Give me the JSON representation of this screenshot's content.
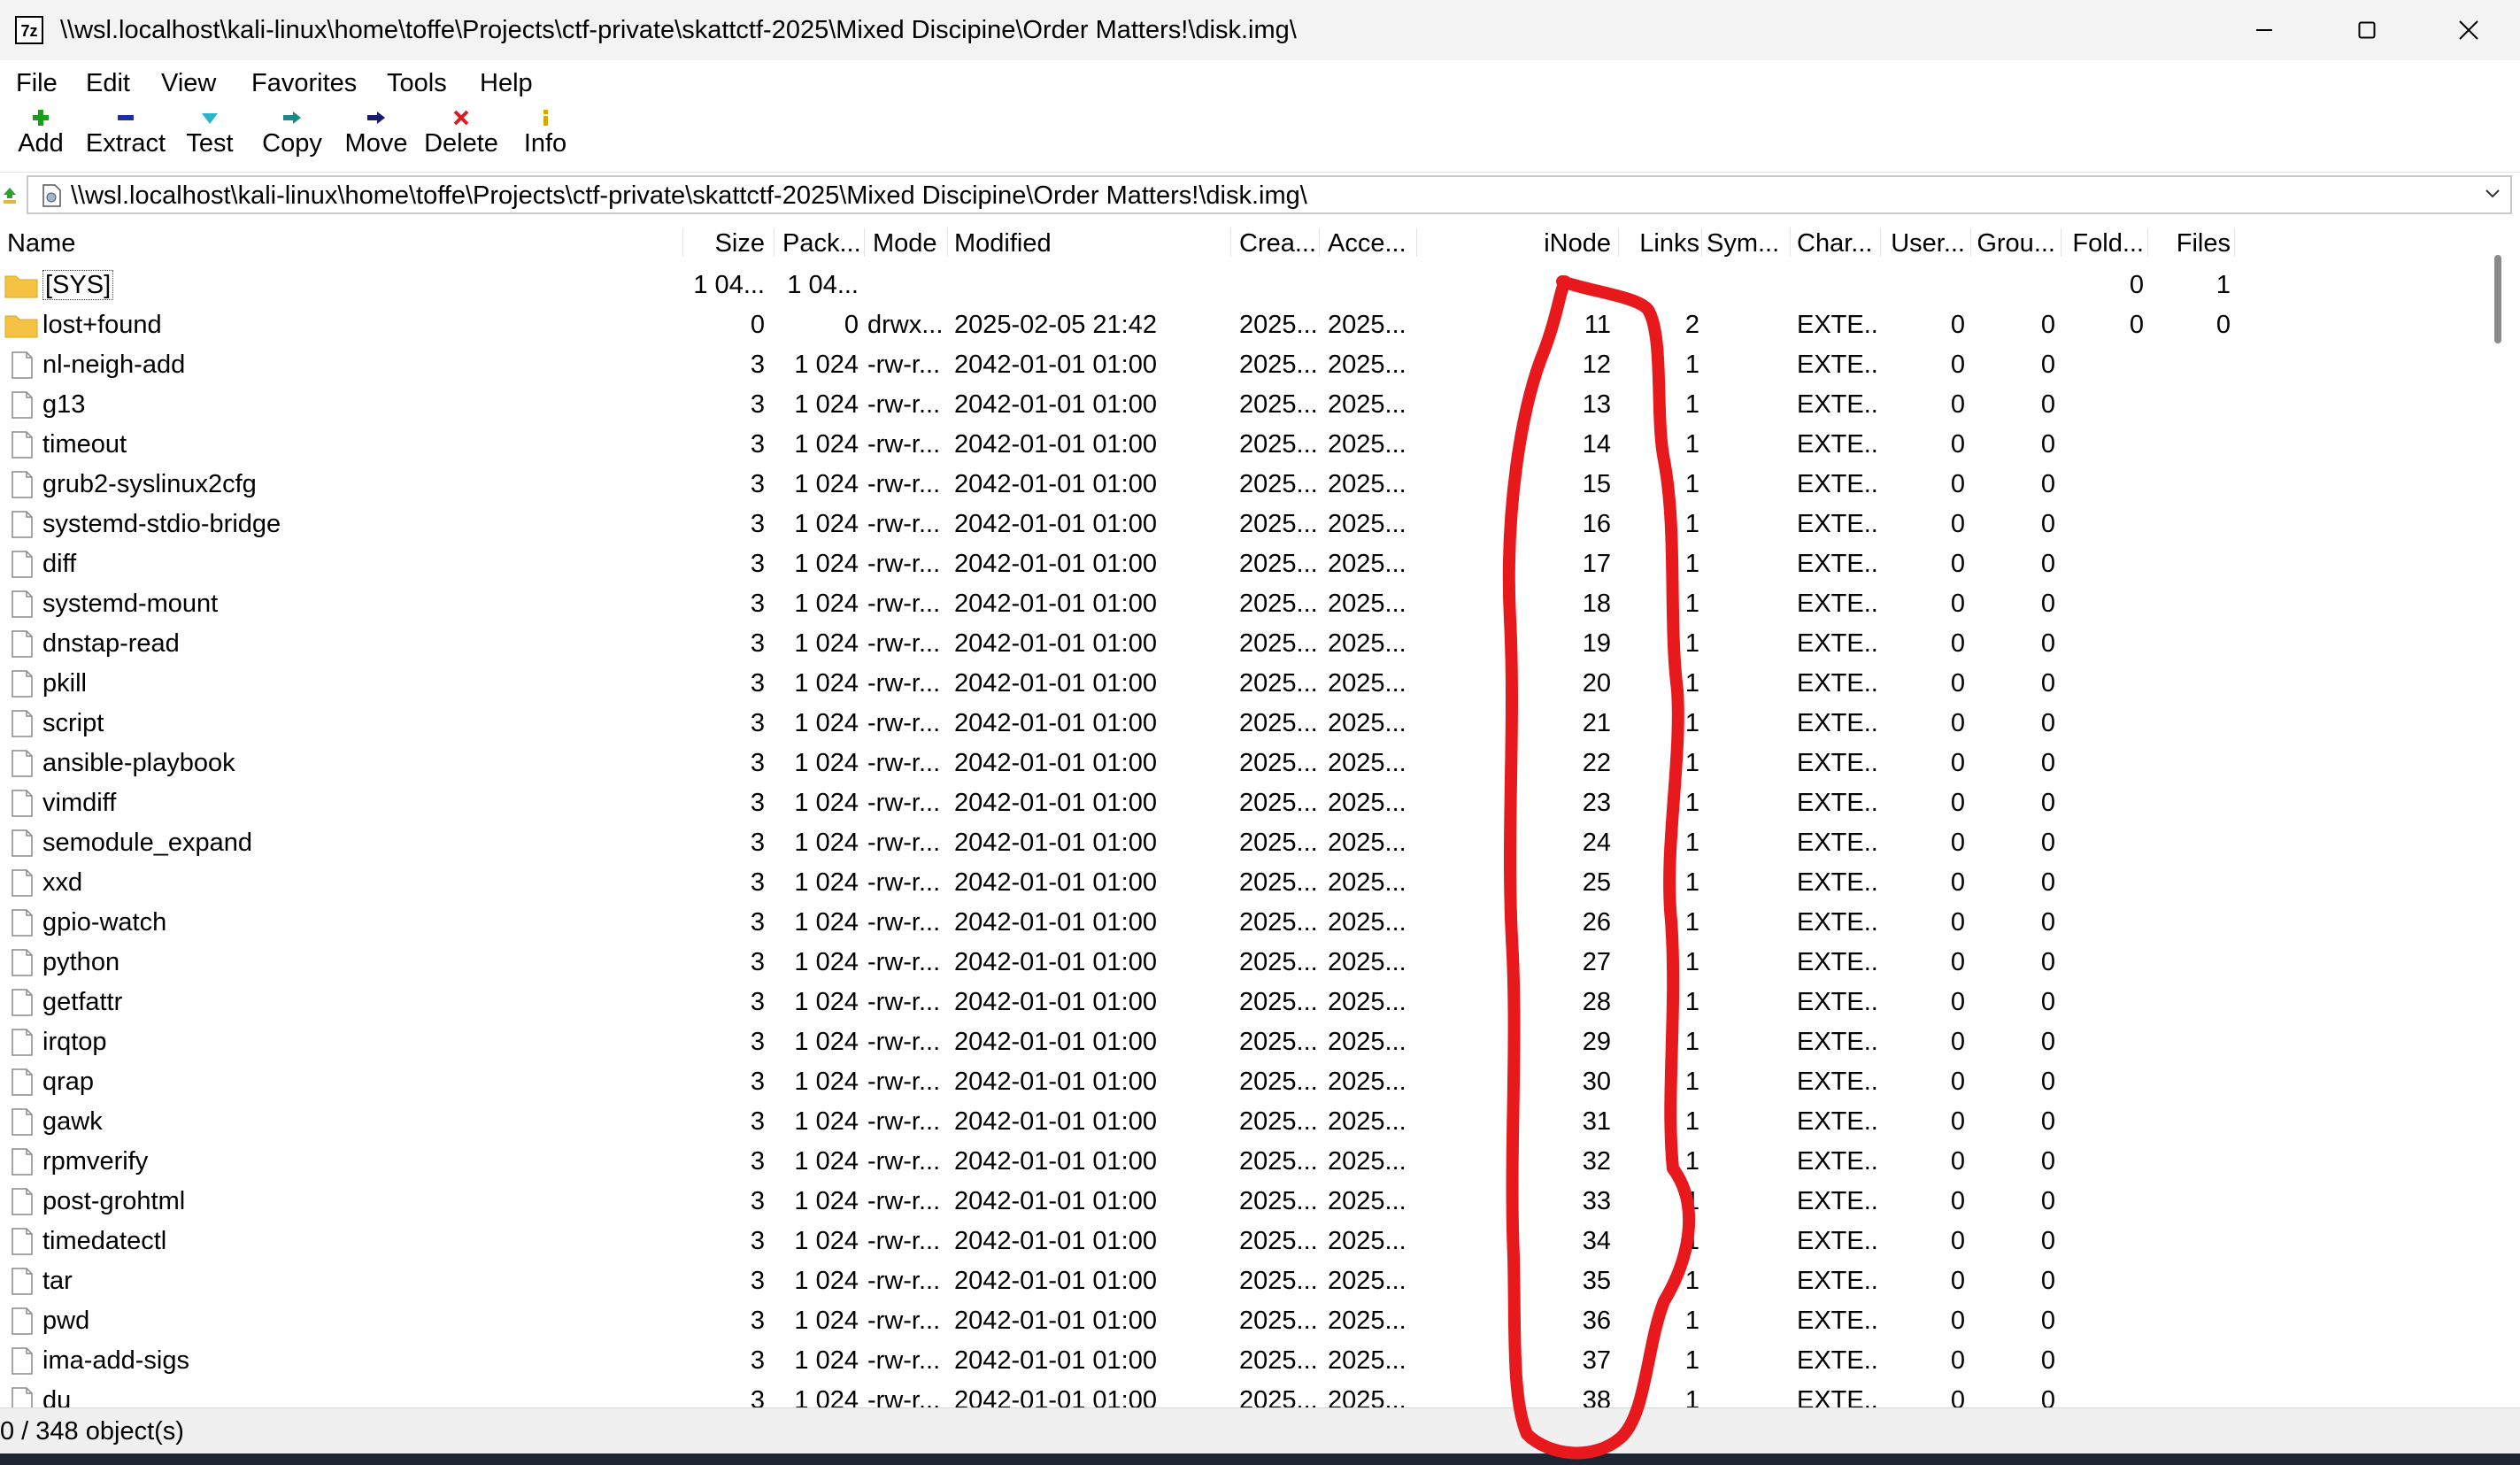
{
  "window": {
    "title": "\\\\wsl.localhost\\kali-linux\\home\\toffe\\Projects\\ctf-private\\skattctf-2025\\Mixed Discipine\\Order Matters!\\disk.img\\",
    "app_icon_text": "7z"
  },
  "menu": [
    "File",
    "Edit",
    "View",
    "Favorites",
    "Tools",
    "Help"
  ],
  "toolbar": {
    "add": "Add",
    "extract": "Extract",
    "test": "Test",
    "copy": "Copy",
    "move": "Move",
    "delete": "Delete",
    "info": "Info"
  },
  "address": {
    "path": "\\\\wsl.localhost\\kali-linux\\home\\toffe\\Projects\\ctf-private\\skattctf-2025\\Mixed Discipine\\Order Matters!\\disk.img\\"
  },
  "columns": {
    "name": "Name",
    "size": "Size",
    "packed": "Pack...",
    "mode": "Mode",
    "modified": "Modified",
    "created": "Crea...",
    "accessed": "Acce...",
    "inode": "iNode",
    "links": "Links",
    "symlink": "Sym...",
    "characteristics": "Char...",
    "user": "User...",
    "group": "Grou...",
    "folders": "Fold...",
    "files": "Files"
  },
  "rows": [
    {
      "name": "[SYS]",
      "type": "folder",
      "size": "1 04...",
      "packed": "1 04...",
      "mode": "",
      "modified": "",
      "created": "",
      "accessed": "",
      "inode": "",
      "links": "",
      "char": "",
      "user": "",
      "group": "",
      "folders": "0",
      "files": "1"
    },
    {
      "name": "lost+found",
      "type": "folder",
      "size": "0",
      "packed": "0",
      "mode": "drwx...",
      "modified": "2025-02-05 21:42",
      "created": "2025...",
      "accessed": "2025...",
      "inode": "11",
      "links": "2",
      "char": "EXTE...",
      "user": "0",
      "group": "0",
      "folders": "0",
      "files": "0"
    },
    {
      "name": "nl-neigh-add",
      "type": "file",
      "size": "3",
      "packed": "1 024",
      "mode": "-rw-r...",
      "modified": "2042-01-01 01:00",
      "created": "2025...",
      "accessed": "2025...",
      "inode": "12",
      "links": "1",
      "char": "EXTE...",
      "user": "0",
      "group": "0",
      "folders": "",
      "files": ""
    },
    {
      "name": "g13",
      "type": "file",
      "size": "3",
      "packed": "1 024",
      "mode": "-rw-r...",
      "modified": "2042-01-01 01:00",
      "created": "2025...",
      "accessed": "2025...",
      "inode": "13",
      "links": "1",
      "char": "EXTE...",
      "user": "0",
      "group": "0",
      "folders": "",
      "files": ""
    },
    {
      "name": "timeout",
      "type": "file",
      "size": "3",
      "packed": "1 024",
      "mode": "-rw-r...",
      "modified": "2042-01-01 01:00",
      "created": "2025...",
      "accessed": "2025...",
      "inode": "14",
      "links": "1",
      "char": "EXTE...",
      "user": "0",
      "group": "0",
      "folders": "",
      "files": ""
    },
    {
      "name": "grub2-syslinux2cfg",
      "type": "file",
      "size": "3",
      "packed": "1 024",
      "mode": "-rw-r...",
      "modified": "2042-01-01 01:00",
      "created": "2025...",
      "accessed": "2025...",
      "inode": "15",
      "links": "1",
      "char": "EXTE...",
      "user": "0",
      "group": "0",
      "folders": "",
      "files": ""
    },
    {
      "name": "systemd-stdio-bridge",
      "type": "file",
      "size": "3",
      "packed": "1 024",
      "mode": "-rw-r...",
      "modified": "2042-01-01 01:00",
      "created": "2025...",
      "accessed": "2025...",
      "inode": "16",
      "links": "1",
      "char": "EXTE...",
      "user": "0",
      "group": "0",
      "folders": "",
      "files": ""
    },
    {
      "name": "diff",
      "type": "file",
      "size": "3",
      "packed": "1 024",
      "mode": "-rw-r...",
      "modified": "2042-01-01 01:00",
      "created": "2025...",
      "accessed": "2025...",
      "inode": "17",
      "links": "1",
      "char": "EXTE...",
      "user": "0",
      "group": "0",
      "folders": "",
      "files": ""
    },
    {
      "name": "systemd-mount",
      "type": "file",
      "size": "3",
      "packed": "1 024",
      "mode": "-rw-r...",
      "modified": "2042-01-01 01:00",
      "created": "2025...",
      "accessed": "2025...",
      "inode": "18",
      "links": "1",
      "char": "EXTE...",
      "user": "0",
      "group": "0",
      "folders": "",
      "files": ""
    },
    {
      "name": "dnstap-read",
      "type": "file",
      "size": "3",
      "packed": "1 024",
      "mode": "-rw-r...",
      "modified": "2042-01-01 01:00",
      "created": "2025...",
      "accessed": "2025...",
      "inode": "19",
      "links": "1",
      "char": "EXTE...",
      "user": "0",
      "group": "0",
      "folders": "",
      "files": ""
    },
    {
      "name": "pkill",
      "type": "file",
      "size": "3",
      "packed": "1 024",
      "mode": "-rw-r...",
      "modified": "2042-01-01 01:00",
      "created": "2025...",
      "accessed": "2025...",
      "inode": "20",
      "links": "1",
      "char": "EXTE...",
      "user": "0",
      "group": "0",
      "folders": "",
      "files": ""
    },
    {
      "name": "script",
      "type": "file",
      "size": "3",
      "packed": "1 024",
      "mode": "-rw-r...",
      "modified": "2042-01-01 01:00",
      "created": "2025...",
      "accessed": "2025...",
      "inode": "21",
      "links": "1",
      "char": "EXTE...",
      "user": "0",
      "group": "0",
      "folders": "",
      "files": ""
    },
    {
      "name": "ansible-playbook",
      "type": "file",
      "size": "3",
      "packed": "1 024",
      "mode": "-rw-r...",
      "modified": "2042-01-01 01:00",
      "created": "2025...",
      "accessed": "2025...",
      "inode": "22",
      "links": "1",
      "char": "EXTE...",
      "user": "0",
      "group": "0",
      "folders": "",
      "files": ""
    },
    {
      "name": "vimdiff",
      "type": "file",
      "size": "3",
      "packed": "1 024",
      "mode": "-rw-r...",
      "modified": "2042-01-01 01:00",
      "created": "2025...",
      "accessed": "2025...",
      "inode": "23",
      "links": "1",
      "char": "EXTE...",
      "user": "0",
      "group": "0",
      "folders": "",
      "files": ""
    },
    {
      "name": "semodule_expand",
      "type": "file",
      "size": "3",
      "packed": "1 024",
      "mode": "-rw-r...",
      "modified": "2042-01-01 01:00",
      "created": "2025...",
      "accessed": "2025...",
      "inode": "24",
      "links": "1",
      "char": "EXTE...",
      "user": "0",
      "group": "0",
      "folders": "",
      "files": ""
    },
    {
      "name": "xxd",
      "type": "file",
      "size": "3",
      "packed": "1 024",
      "mode": "-rw-r...",
      "modified": "2042-01-01 01:00",
      "created": "2025...",
      "accessed": "2025...",
      "inode": "25",
      "links": "1",
      "char": "EXTE...",
      "user": "0",
      "group": "0",
      "folders": "",
      "files": ""
    },
    {
      "name": "gpio-watch",
      "type": "file",
      "size": "3",
      "packed": "1 024",
      "mode": "-rw-r...",
      "modified": "2042-01-01 01:00",
      "created": "2025...",
      "accessed": "2025...",
      "inode": "26",
      "links": "1",
      "char": "EXTE...",
      "user": "0",
      "group": "0",
      "folders": "",
      "files": ""
    },
    {
      "name": "python",
      "type": "file",
      "size": "3",
      "packed": "1 024",
      "mode": "-rw-r...",
      "modified": "2042-01-01 01:00",
      "created": "2025...",
      "accessed": "2025...",
      "inode": "27",
      "links": "1",
      "char": "EXTE...",
      "user": "0",
      "group": "0",
      "folders": "",
      "files": ""
    },
    {
      "name": "getfattr",
      "type": "file",
      "size": "3",
      "packed": "1 024",
      "mode": "-rw-r...",
      "modified": "2042-01-01 01:00",
      "created": "2025...",
      "accessed": "2025...",
      "inode": "28",
      "links": "1",
      "char": "EXTE...",
      "user": "0",
      "group": "0",
      "folders": "",
      "files": ""
    },
    {
      "name": "irqtop",
      "type": "file",
      "size": "3",
      "packed": "1 024",
      "mode": "-rw-r...",
      "modified": "2042-01-01 01:00",
      "created": "2025...",
      "accessed": "2025...",
      "inode": "29",
      "links": "1",
      "char": "EXTE...",
      "user": "0",
      "group": "0",
      "folders": "",
      "files": ""
    },
    {
      "name": "qrap",
      "type": "file",
      "size": "3",
      "packed": "1 024",
      "mode": "-rw-r...",
      "modified": "2042-01-01 01:00",
      "created": "2025...",
      "accessed": "2025...",
      "inode": "30",
      "links": "1",
      "char": "EXTE...",
      "user": "0",
      "group": "0",
      "folders": "",
      "files": ""
    },
    {
      "name": "gawk",
      "type": "file",
      "size": "3",
      "packed": "1 024",
      "mode": "-rw-r...",
      "modified": "2042-01-01 01:00",
      "created": "2025...",
      "accessed": "2025...",
      "inode": "31",
      "links": "1",
      "char": "EXTE...",
      "user": "0",
      "group": "0",
      "folders": "",
      "files": ""
    },
    {
      "name": "rpmverify",
      "type": "file",
      "size": "3",
      "packed": "1 024",
      "mode": "-rw-r...",
      "modified": "2042-01-01 01:00",
      "created": "2025...",
      "accessed": "2025...",
      "inode": "32",
      "links": "1",
      "char": "EXTE...",
      "user": "0",
      "group": "0",
      "folders": "",
      "files": ""
    },
    {
      "name": "post-grohtml",
      "type": "file",
      "size": "3",
      "packed": "1 024",
      "mode": "-rw-r...",
      "modified": "2042-01-01 01:00",
      "created": "2025...",
      "accessed": "2025...",
      "inode": "33",
      "links": "1",
      "char": "EXTE...",
      "user": "0",
      "group": "0",
      "folders": "",
      "files": ""
    },
    {
      "name": "timedatectl",
      "type": "file",
      "size": "3",
      "packed": "1 024",
      "mode": "-rw-r...",
      "modified": "2042-01-01 01:00",
      "created": "2025...",
      "accessed": "2025...",
      "inode": "34",
      "links": "1",
      "char": "EXTE...",
      "user": "0",
      "group": "0",
      "folders": "",
      "files": ""
    },
    {
      "name": "tar",
      "type": "file",
      "size": "3",
      "packed": "1 024",
      "mode": "-rw-r...",
      "modified": "2042-01-01 01:00",
      "created": "2025...",
      "accessed": "2025...",
      "inode": "35",
      "links": "1",
      "char": "EXTE...",
      "user": "0",
      "group": "0",
      "folders": "",
      "files": ""
    },
    {
      "name": "pwd",
      "type": "file",
      "size": "3",
      "packed": "1 024",
      "mode": "-rw-r...",
      "modified": "2042-01-01 01:00",
      "created": "2025...",
      "accessed": "2025...",
      "inode": "36",
      "links": "1",
      "char": "EXTE...",
      "user": "0",
      "group": "0",
      "folders": "",
      "files": ""
    },
    {
      "name": "ima-add-sigs",
      "type": "file",
      "size": "3",
      "packed": "1 024",
      "mode": "-rw-r...",
      "modified": "2042-01-01 01:00",
      "created": "2025...",
      "accessed": "2025...",
      "inode": "37",
      "links": "1",
      "char": "EXTE...",
      "user": "0",
      "group": "0",
      "folders": "",
      "files": ""
    },
    {
      "name": "du",
      "type": "file",
      "size": "3",
      "packed": "1 024",
      "mode": "-rw-r...",
      "modified": "2042-01-01 01:00",
      "created": "2025...",
      "accessed": "2025...",
      "inode": "38",
      "links": "1",
      "char": "EXTE...",
      "user": "0",
      "group": "0",
      "folders": "",
      "files": ""
    }
  ],
  "status": {
    "text": "0 / 348 object(s)"
  },
  "colors": {
    "annotation": "#e8191c",
    "folder": "#f6c244",
    "add": "#1a9e1a",
    "extract": "#1f2fa3",
    "test": "#2bb4c9",
    "copy": "#1d8a8a",
    "move": "#1a1a6e",
    "delete": "#d61f1f",
    "info": "#d6a800"
  }
}
